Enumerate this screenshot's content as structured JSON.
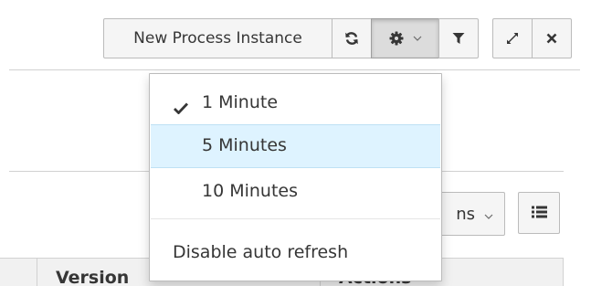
{
  "toolbar": {
    "new_instance_label": "New Process Instance",
    "refresh_icon": "refresh-icon",
    "settings_icon": "gear-icon",
    "filter_icon": "filter-icon",
    "expand_icon": "expand-icon",
    "close_icon": "close-icon"
  },
  "auto_refresh_menu": {
    "items": [
      {
        "label": "1 Minute",
        "checked": true
      },
      {
        "label": "5 Minutes",
        "highlighted": true
      },
      {
        "label": "10 Minutes"
      }
    ],
    "disable_label": "Disable auto refresh"
  },
  "controls": {
    "columns_label_partial": "ns",
    "list_icon": "list-icon"
  },
  "table": {
    "headers": [
      "Version",
      "Actions"
    ]
  },
  "colors": {
    "highlight": "#def3ff",
    "button_bg": "#f5f5f5",
    "border": "#bbbbbb"
  }
}
